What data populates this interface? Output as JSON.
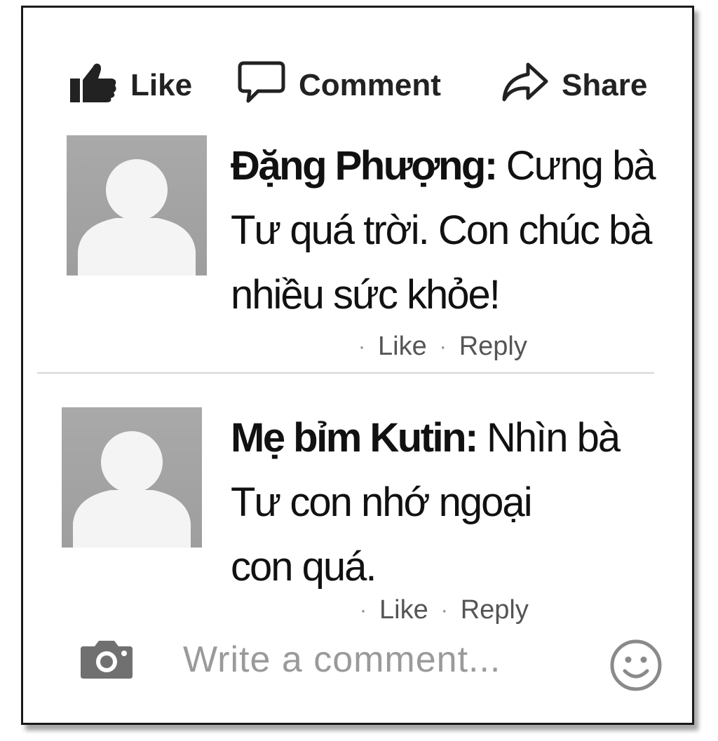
{
  "actions": {
    "like_label": "Like",
    "comment_label": "Comment",
    "share_label": "Share"
  },
  "comments": [
    {
      "author": "Đặng Phượng:",
      "lines": [
        "Cưng bà",
        "Tư quá trời. Con chúc bà",
        "nhiều sức khỏe!"
      ],
      "like_label": "Like",
      "reply_label": "Reply"
    },
    {
      "author": "Mẹ bỉm Kutin:",
      "lines": [
        "Nhìn bà",
        "Tư con nhớ ngoại",
        "con quá."
      ],
      "like_label": "Like",
      "reply_label": "Reply"
    }
  ],
  "composer": {
    "placeholder": "Write a comment..."
  },
  "icons": {
    "like": "thumbs-up-icon",
    "comment": "speech-bubble-icon",
    "share": "share-arrow-icon",
    "camera": "camera-icon",
    "emoji": "smiley-icon"
  }
}
